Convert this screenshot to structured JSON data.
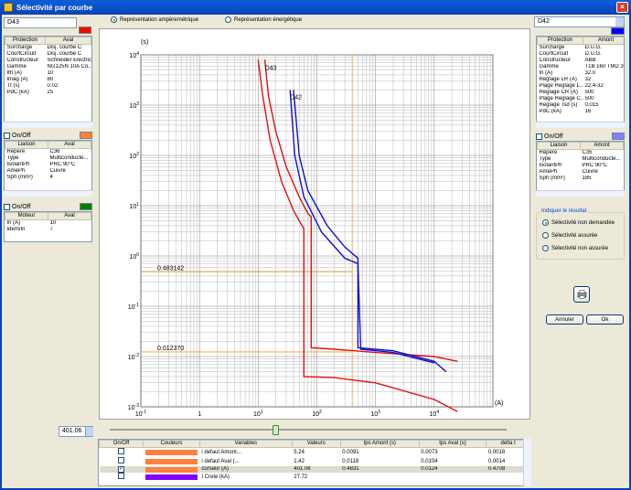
{
  "window": {
    "title": "Sélectivité par courbe",
    "close": "×"
  },
  "view_options": {
    "amp": "Représentation ampèremétrique",
    "energy": "Représentation énergétique",
    "selected": "amp"
  },
  "left": {
    "device": "D43",
    "color": "#ff0000",
    "protection": {
      "headers": [
        "Protection",
        "Aval"
      ],
      "rows": [
        [
          "Surcharge",
          "Disj. courbe C"
        ],
        [
          "CourtCircuit",
          "Disj. courbe C"
        ],
        [
          "Constructeur",
          "Schneider Electric"
        ],
        [
          "Gamme",
          "NG125N 10A Co..."
        ],
        [
          "Ith (A)",
          "10"
        ],
        [
          "Imag (A)",
          "80"
        ],
        [
          "Tt (s)",
          "0.02"
        ],
        [
          "PdC (kA)",
          "25"
        ]
      ]
    },
    "onoff1": "On/Off",
    "onoff1_color": "#ff8040",
    "liaison": {
      "headers": [
        "Liaison",
        "Aval"
      ],
      "rows": [
        [
          "Repere",
          "C36"
        ],
        [
          "Type",
          "Multiconducte..."
        ],
        [
          "IsolantPh",
          "PRC 90°C"
        ],
        [
          "AmePh",
          "Cuivre"
        ],
        [
          "Sph (mm²)",
          "4"
        ]
      ]
    },
    "onoff2": "On/Off",
    "onoff2_color": "#008000",
    "moteur": {
      "headers": [
        "Moteur",
        "Aval"
      ],
      "rows": [
        [
          "In (A)",
          "10"
        ],
        [
          "Idem/In",
          "7"
        ]
      ]
    }
  },
  "right": {
    "device": "D42",
    "color": "#0000ff",
    "protection": {
      "headers": [
        "Protection",
        "Amont"
      ],
      "rows": [
        [
          "Surcharge",
          "D.U.G."
        ],
        [
          "CourtCircuit",
          "D.U.G."
        ],
        [
          "Constructeur",
          "ABB"
        ],
        [
          "Gamme",
          "T1B 160 TMD 3..."
        ],
        [
          "In (A)",
          "32.0"
        ],
        [
          "Reglage LR (A)",
          "32"
        ],
        [
          "Plage Reglage L...",
          "22.4-32"
        ],
        [
          "Reglage CR (A)",
          "500"
        ],
        [
          "Plage Reglage C...",
          "500"
        ],
        [
          "Reglage Tsd (s)",
          "0.015"
        ],
        [
          "PdC (kA)",
          "16"
        ]
      ]
    },
    "onoff1": "On/Off",
    "onoff1_color": "#8080ff",
    "liaison": {
      "headers": [
        "Liaison",
        "Amont"
      ],
      "rows": [
        [
          "Repere",
          "C35"
        ],
        [
          "Type",
          "Multiconducte..."
        ],
        [
          "IsolantPh",
          "PRC 90°C"
        ],
        [
          "AmePh",
          "Cuivre"
        ],
        [
          "Sph (mm²)",
          "185"
        ]
      ]
    },
    "result": {
      "title": "Indiquer le résultat",
      "options": [
        "Sélectivité non demandée",
        "Sélectivité assurée",
        "Sélectivité non assurée"
      ],
      "selected": 0
    },
    "cancel": "Annuler",
    "ok": "Ok",
    "print_icon": "printer-icon"
  },
  "chart_data": {
    "type": "line",
    "log_x": true,
    "log_y": true,
    "xlim": [
      0.1,
      100000
    ],
    "ylim": [
      0.001,
      10000
    ],
    "ylabel": "(s)",
    "xlabel": "(A)",
    "cursor_label": "Curseur",
    "x_ticks": [
      {
        "b": "10",
        "e": "-1"
      },
      {
        "b": "1",
        "e": ""
      },
      {
        "b": "10",
        "e": "1"
      },
      {
        "b": "10",
        "e": "2"
      },
      {
        "b": "10",
        "e": "3"
      },
      {
        "b": "10",
        "e": "4"
      }
    ],
    "y_ticks": [
      {
        "b": "10",
        "e": "4"
      },
      {
        "b": "10",
        "e": "3"
      },
      {
        "b": "10",
        "e": "2"
      },
      {
        "b": "10",
        "e": "1"
      },
      {
        "b": "10",
        "e": "0"
      },
      {
        "b": "10",
        "e": "-1"
      },
      {
        "b": "10",
        "e": "-2"
      },
      {
        "b": "10",
        "e": "-3"
      }
    ],
    "cursor_x": 401.06,
    "hlines": [
      {
        "y": 0.483142,
        "label": "0.483142"
      },
      {
        "y": 0.01237,
        "label": "0.012370"
      }
    ],
    "series": [
      {
        "name": "D43",
        "color": "#e01010",
        "points": [
          [
            13,
            8000
          ],
          [
            15,
            1500
          ],
          [
            20,
            300
          ],
          [
            30,
            60
          ],
          [
            50,
            15
          ],
          [
            70,
            7
          ],
          [
            80,
            6
          ],
          [
            80,
            0.015
          ],
          [
            200,
            0.014
          ],
          [
            1000,
            0.012
          ],
          [
            10000,
            0.01
          ],
          [
            25000,
            0.008
          ]
        ]
      },
      {
        "name": "D43",
        "color": "#e01010",
        "points": [
          [
            10,
            8000
          ],
          [
            12,
            1500
          ],
          [
            16,
            200
          ],
          [
            25,
            30
          ],
          [
            40,
            8
          ],
          [
            56,
            4
          ],
          [
            60,
            3.5
          ],
          [
            60,
            0.004
          ],
          [
            200,
            0.0038
          ],
          [
            1000,
            0.003
          ],
          [
            10000,
            0.0014
          ],
          [
            25000,
            0.0008
          ]
        ]
      },
      {
        "name": "D42",
        "color": "#1010c8",
        "points": [
          [
            40,
            2000
          ],
          [
            50,
            100
          ],
          [
            70,
            20
          ],
          [
            150,
            4
          ],
          [
            300,
            1.5
          ],
          [
            500,
            0.9
          ],
          [
            500,
            0.015
          ],
          [
            2000,
            0.013
          ],
          [
            10000,
            0.008
          ],
          [
            16000,
            0.005
          ]
        ]
      },
      {
        "name": "D42",
        "color": "#1010c8",
        "points": [
          [
            35,
            2000
          ],
          [
            42,
            100
          ],
          [
            60,
            15
          ],
          [
            120,
            3
          ],
          [
            300,
            0.9
          ],
          [
            500,
            0.7
          ],
          [
            560,
            0.014
          ],
          [
            2000,
            0.012
          ],
          [
            10000,
            0.0075
          ]
        ]
      }
    ],
    "series_labels": [
      {
        "text": "D43",
        "x": 13,
        "y": 5000
      },
      {
        "text": "D42",
        "x": 35,
        "y": 1300
      }
    ]
  },
  "cursor_value": "401.06",
  "bottom_table": {
    "headers": [
      "On/Off",
      "Couleurs",
      "Variables",
      "Valeurs",
      "tps Amont (s)",
      "tps Aval (s)",
      "delta t"
    ],
    "rows": [
      {
        "checked": false,
        "color": "#ff8040",
        "variable": "i defaut Amont...",
        "value": "5.24",
        "amont": "0.0091",
        "aval": "0.0073",
        "delta": "0.0018"
      },
      {
        "checked": false,
        "color": "#ff8040",
        "variable": "i defaut Aval (...",
        "value": "1.42",
        "amont": "0.0118",
        "aval": "0.0104",
        "delta": "0.0014"
      },
      {
        "checked": true,
        "color": "#ff8040",
        "variable": "curseur (A)",
        "value": "401.06",
        "amont": "0.4831",
        "aval": "0.0124",
        "delta": "0.4708"
      },
      {
        "checked": false,
        "color": "#8000ff",
        "variable": "I Crete (kA)",
        "value": "27.72",
        "amont": "",
        "aval": "",
        "delta": ""
      }
    ]
  }
}
